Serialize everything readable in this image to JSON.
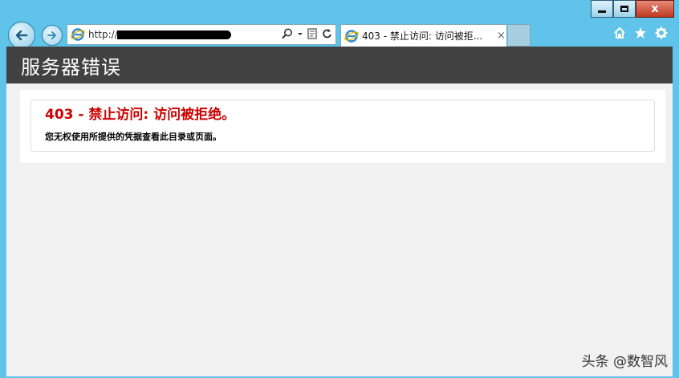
{
  "browser": {
    "address_url": "http://w",
    "tab_title": "403 - 禁止访问: 访问被拒...",
    "tab_close": "×",
    "window_close": "x"
  },
  "page": {
    "header_title": "服务器错误",
    "error_heading": "403 - 禁止访问: 访问被拒绝。",
    "error_description": "您无权使用所提供的凭据查看此目录或页面。"
  },
  "watermark": "头条 @数智风",
  "colors": {
    "chrome": "#5fc3ea",
    "header_bg": "#414141",
    "error_red": "#cc0000",
    "page_bg": "#f1f1f1"
  },
  "icons": [
    "back-arrow-icon",
    "forward-arrow-icon",
    "ie-logo-icon",
    "search-icon",
    "dropdown-icon",
    "compatibility-view-icon",
    "refresh-icon",
    "home-icon",
    "favorites-star-icon",
    "settings-gear-icon"
  ]
}
